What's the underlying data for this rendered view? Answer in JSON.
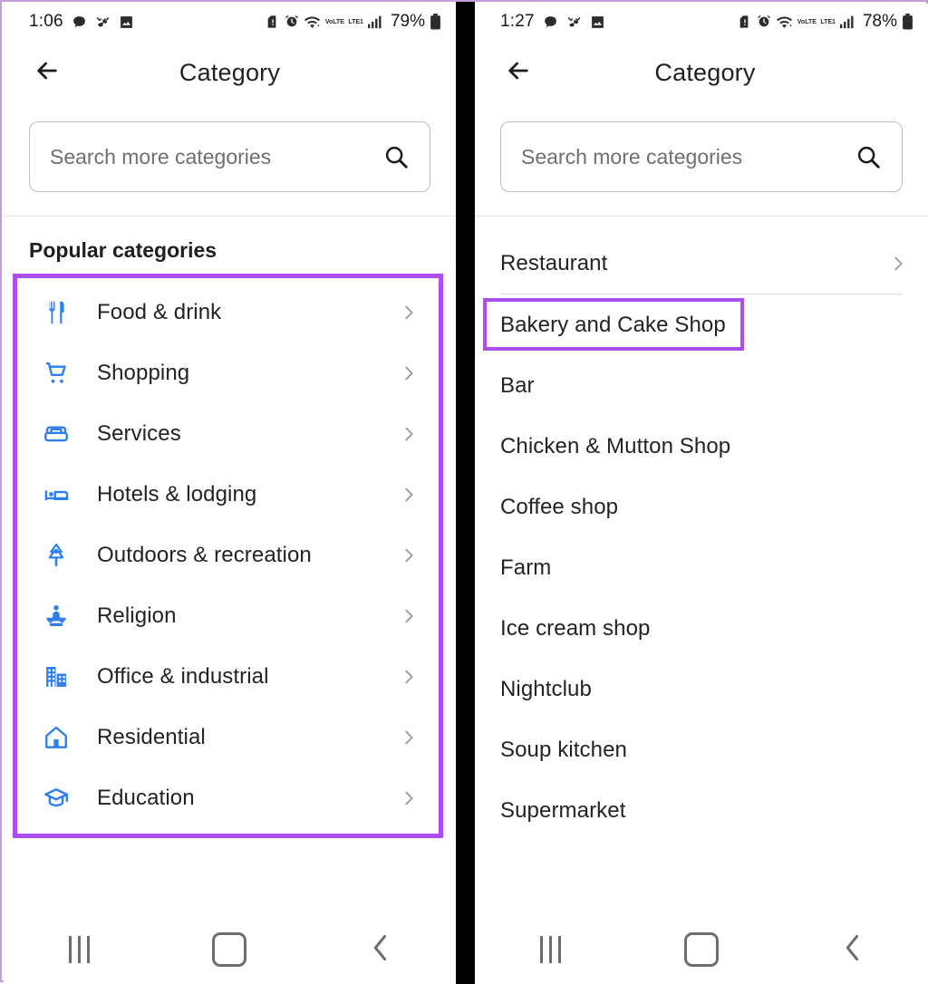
{
  "theme": {
    "accent_purple": "#ae4ef0",
    "icon_blue": "#2d7ff0",
    "text_primary": "#232323",
    "text_muted": "#6f6f6f",
    "divider": "#e0e0e0",
    "page_border": "#c79ad8",
    "gutter": "#000000"
  },
  "left": {
    "statusbar": {
      "time": "1:06",
      "battery_pct": "79%",
      "volte_label": "VoLTE",
      "lte_label": "LTE1",
      "icons": [
        "chat-icon",
        "missed-call-icon",
        "image-icon",
        "sim-alert-icon",
        "alarm-icon",
        "wifi-icon",
        "volte-icon",
        "signal-bars-icon",
        "battery-icon"
      ]
    },
    "appbar": {
      "back_icon": "back-arrow-icon",
      "title": "Category"
    },
    "search": {
      "placeholder": "Search more categories",
      "value": "",
      "icon": "search-icon"
    },
    "section_title": "Popular categories",
    "categories": [
      {
        "label": "Food & drink",
        "icon": "restaurant-icon"
      },
      {
        "label": "Shopping",
        "icon": "shopping-cart-icon"
      },
      {
        "label": "Services",
        "icon": "armchair-icon"
      },
      {
        "label": "Hotels & lodging",
        "icon": "bed-icon"
      },
      {
        "label": "Outdoors & recreation",
        "icon": "tree-icon"
      },
      {
        "label": "Religion",
        "icon": "meditation-icon"
      },
      {
        "label": "Office & industrial",
        "icon": "office-building-icon"
      },
      {
        "label": "Residential",
        "icon": "home-icon"
      },
      {
        "label": "Education",
        "icon": "graduation-cap-icon"
      }
    ],
    "navbar": {
      "recents": "recents-icon",
      "home": "home-nav-icon",
      "back": "back-nav-icon"
    }
  },
  "right": {
    "statusbar": {
      "time": "1:27",
      "battery_pct": "78%",
      "volte_label": "VoLTE",
      "lte_label": "LTE1"
    },
    "appbar": {
      "back_icon": "back-arrow-icon",
      "title": "Category"
    },
    "search": {
      "placeholder": "Search more categories",
      "value": "",
      "icon": "search-icon"
    },
    "items": [
      {
        "label": "Restaurant",
        "chevron": true,
        "divider_after": true,
        "highlighted": false
      },
      {
        "label": "Bakery and Cake Shop",
        "chevron": false,
        "divider_after": false,
        "highlighted": true
      },
      {
        "label": "Bar",
        "chevron": false,
        "divider_after": false,
        "highlighted": false
      },
      {
        "label": "Chicken & Mutton Shop",
        "chevron": false,
        "divider_after": false,
        "highlighted": false
      },
      {
        "label": "Coffee shop",
        "chevron": false,
        "divider_after": false,
        "highlighted": false
      },
      {
        "label": "Farm",
        "chevron": false,
        "divider_after": false,
        "highlighted": false
      },
      {
        "label": "Ice cream shop",
        "chevron": false,
        "divider_after": false,
        "highlighted": false
      },
      {
        "label": "Nightclub",
        "chevron": false,
        "divider_after": false,
        "highlighted": false
      },
      {
        "label": "Soup kitchen",
        "chevron": false,
        "divider_after": false,
        "highlighted": false
      },
      {
        "label": "Supermarket",
        "chevron": false,
        "divider_after": false,
        "highlighted": false
      }
    ],
    "navbar": {
      "recents": "recents-icon",
      "home": "home-nav-icon",
      "back": "back-nav-icon"
    }
  }
}
